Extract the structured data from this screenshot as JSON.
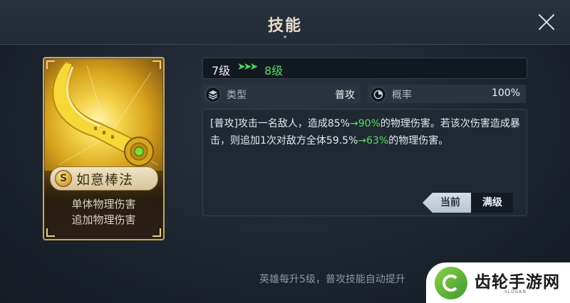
{
  "header": {
    "title": "技能",
    "ornament": "✦"
  },
  "skill_card": {
    "badge": "S",
    "name": "如意棒法",
    "tags": [
      "单体物理伤害",
      "追加物理伤害"
    ]
  },
  "level": {
    "current": "7级",
    "arrows": "➤➤➤",
    "next": "8级"
  },
  "info": {
    "type_label": "类型",
    "type_value": "普攻",
    "rate_label": "概率",
    "rate_value": "100%"
  },
  "description": {
    "p1": "[普攻]攻击一名敌人，造成85%",
    "p2": "→90%",
    "p3": "的物理伤害。若该次伤害造成暴击，则追加1次对敌方全体59.5%",
    "p4": "→63%",
    "p5": "的物理伤害。"
  },
  "tabs": {
    "current": "当前",
    "max": "满级"
  },
  "footer": {
    "note": "英雄每升5级，普攻技能自动提升"
  },
  "watermark": {
    "name": "齿轮手游网",
    "slogan": "SLOGAN"
  },
  "colors": {
    "green": "#53e05f",
    "gold": "#c9a85a"
  },
  "icons": [
    "close-icon",
    "layers-icon",
    "probability-icon",
    "golden-staff-icon"
  ]
}
